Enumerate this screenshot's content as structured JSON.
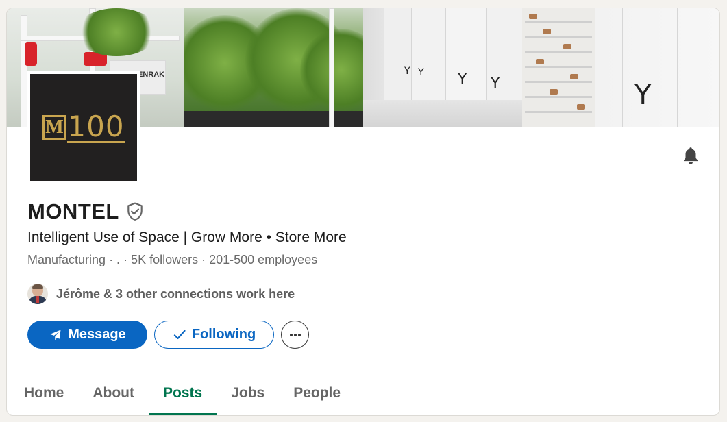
{
  "company": {
    "name": "MONTEL",
    "tagline": "Intelligent Use of Space | Grow More • Store More",
    "meta": "Manufacturing · . · 5K followers · 201-500 employees",
    "logo_letter": "M",
    "logo_number": "100",
    "banner_sign": "ENRAK"
  },
  "connections": {
    "text": "Jérôme & 3 other connections work here"
  },
  "actions": {
    "message_label": "Message",
    "following_label": "Following",
    "more_icon": "ellipsis-icon",
    "bell_icon": "bell-icon"
  },
  "tabs": [
    {
      "label": "Home",
      "active": false
    },
    {
      "label": "About",
      "active": false
    },
    {
      "label": "Posts",
      "active": true
    },
    {
      "label": "Jobs",
      "active": false
    },
    {
      "label": "People",
      "active": false
    }
  ],
  "colors": {
    "primary": "#0a66c2",
    "active_tab": "#01754f",
    "logo_gold": "#c9a54f",
    "logo_bg": "#222020"
  }
}
